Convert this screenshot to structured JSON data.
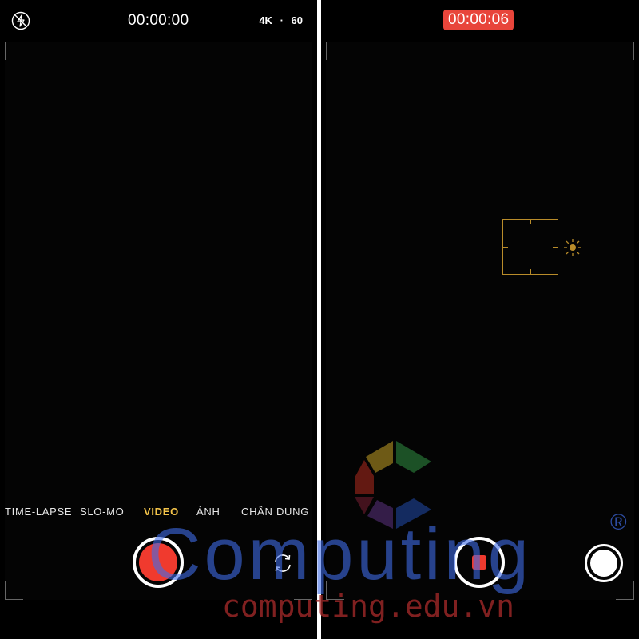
{
  "left_screen": {
    "timer": "00:00:00",
    "format": {
      "resolution": "4K",
      "separator": "·",
      "fps": "60"
    },
    "modes": [
      {
        "label": "TIME-LAPSE",
        "active": false
      },
      {
        "label": "SLO-MO",
        "active": false
      },
      {
        "label": "VIDEO",
        "active": true
      },
      {
        "label": "ẢNH",
        "active": false
      },
      {
        "label": "CHÂN DUNG",
        "active": false
      }
    ],
    "icons": {
      "flash": "flash-off-icon",
      "switch_camera": "camera-flip-icon"
    }
  },
  "right_screen": {
    "timer": "00:00:06",
    "icons": {
      "exposure": "sun-icon"
    }
  },
  "watermark": {
    "brand": "Computing",
    "registered": "®",
    "url": "computing.edu.vn"
  },
  "colors": {
    "record_red": "#f03a2e",
    "timer_badge": "#e8453b",
    "active_mode": "#f5c54a",
    "focus": "#b98c2a",
    "watermark_blue": "#406ce8",
    "watermark_red": "#a02828"
  }
}
